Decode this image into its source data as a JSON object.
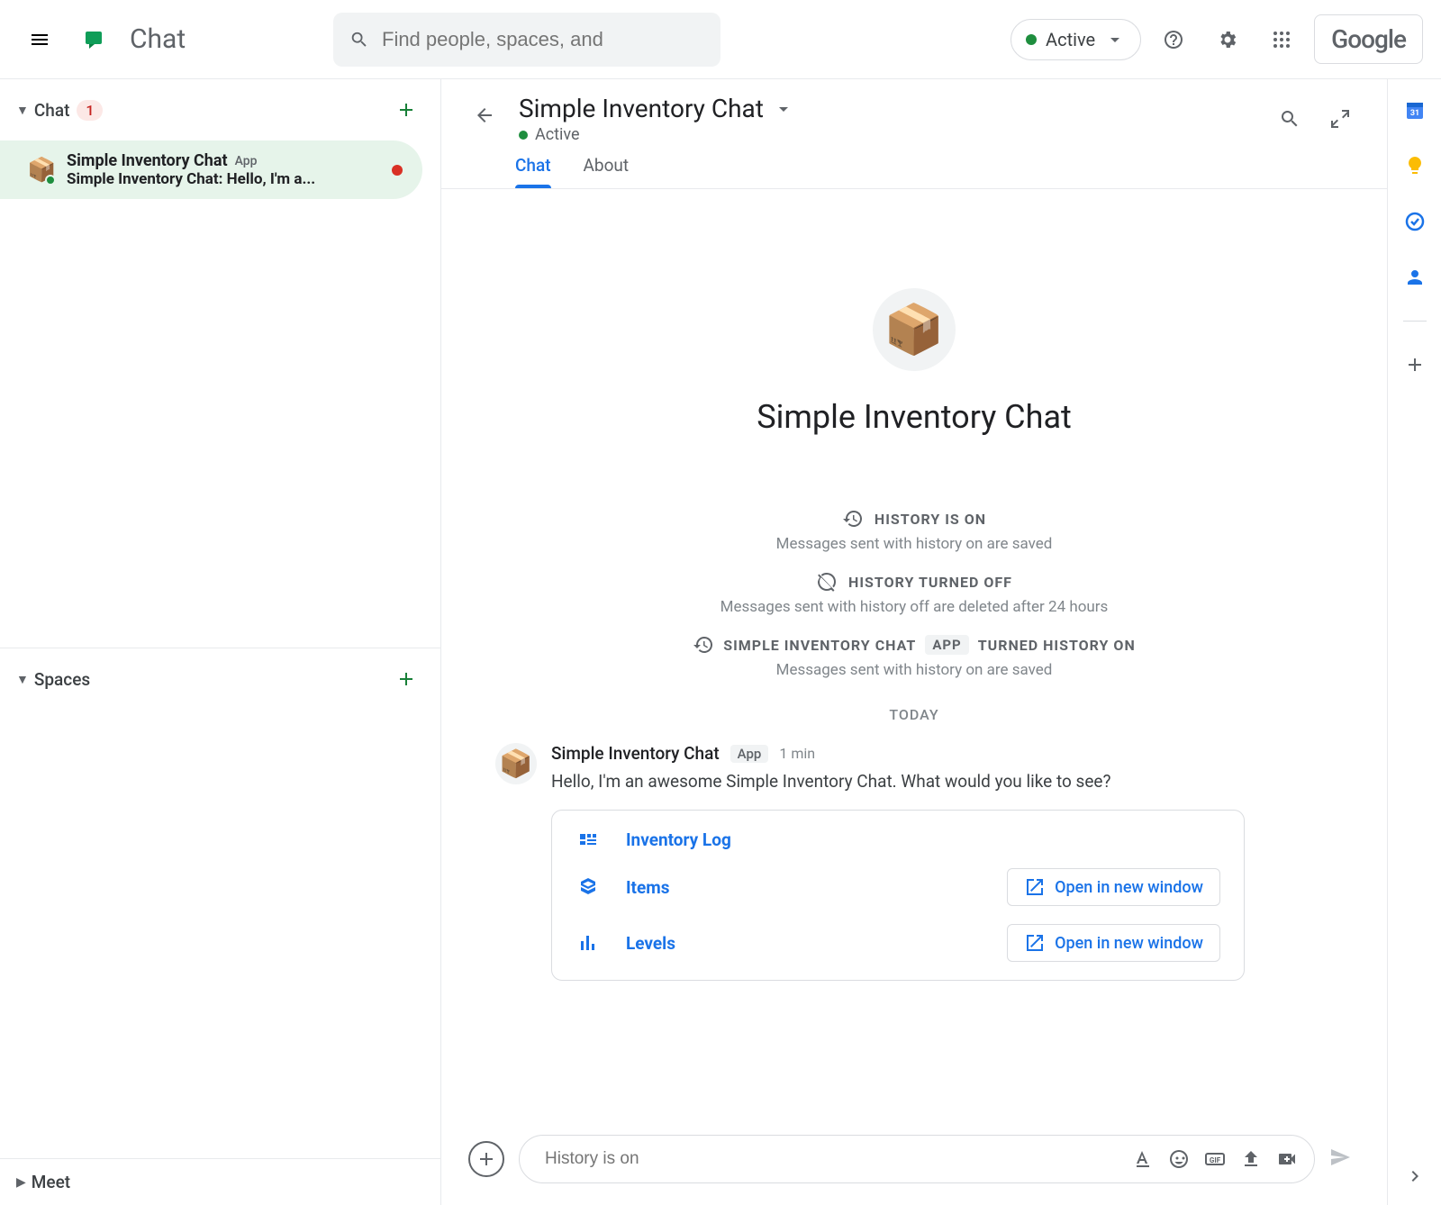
{
  "app": {
    "name": "Chat",
    "search_placeholder": "Find people, spaces, and",
    "status": "Active",
    "google_label": "Google"
  },
  "sidebar": {
    "chat_section": {
      "title": "Chat",
      "unread": "1"
    },
    "spaces_section": {
      "title": "Spaces"
    },
    "meet_section": {
      "title": "Meet"
    },
    "items": [
      {
        "name": "Simple Inventory Chat",
        "type_tag": "App",
        "preview": "Simple Inventory Chat: Hello, I'm a..."
      }
    ]
  },
  "conversation": {
    "title": "Simple Inventory Chat",
    "status": "Active",
    "tabs": {
      "chat": "Chat",
      "about": "About"
    },
    "intro_title": "Simple Inventory Chat",
    "history_on": {
      "title": "HISTORY IS ON",
      "sub": "Messages sent with history on are saved"
    },
    "history_off": {
      "title": "HISTORY TURNED OFF",
      "sub": "Messages sent with history off are deleted after 24 hours"
    },
    "history_event": {
      "prefix": "SIMPLE INVENTORY CHAT",
      "tag": "APP",
      "suffix": "TURNED HISTORY ON",
      "sub": "Messages sent with history on are saved"
    },
    "today": "TODAY",
    "message": {
      "sender": "Simple Inventory Chat",
      "type_tag": "App",
      "time": "1 min",
      "text": "Hello, I'm an awesome  Simple Inventory Chat. What would you like to see?"
    },
    "card": {
      "rows": [
        {
          "label": "Inventory Log",
          "action": null
        },
        {
          "label": "Items",
          "action": "Open in new window"
        },
        {
          "label": "Levels",
          "action": "Open in new window"
        }
      ]
    },
    "compose_placeholder": "History is on"
  }
}
